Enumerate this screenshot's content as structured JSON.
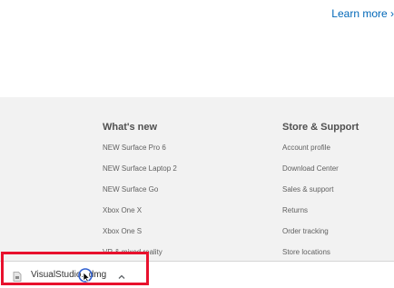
{
  "header": {
    "learn_more": "Learn more ›"
  },
  "footer": {
    "whats_new": {
      "heading": "What's new",
      "links": [
        "NEW Surface Pro 6",
        "NEW Surface Laptop 2",
        "NEW Surface Go",
        "Xbox One X",
        "Xbox One S",
        "VR & mixed reality"
      ]
    },
    "store_support": {
      "heading": "Store & Support",
      "links": [
        "Account profile",
        "Download Center",
        "Sales & support",
        "Returns",
        "Order tracking",
        "Store locations"
      ]
    }
  },
  "download_bar": {
    "file_name": "VisualStudio...dmg",
    "file_icon": "file-icon",
    "expand_icon": "chevron-up-icon"
  },
  "colors": {
    "link_blue": "#0067b8",
    "footer_bg": "#f2f2f2",
    "highlight_red": "#e8112d"
  }
}
